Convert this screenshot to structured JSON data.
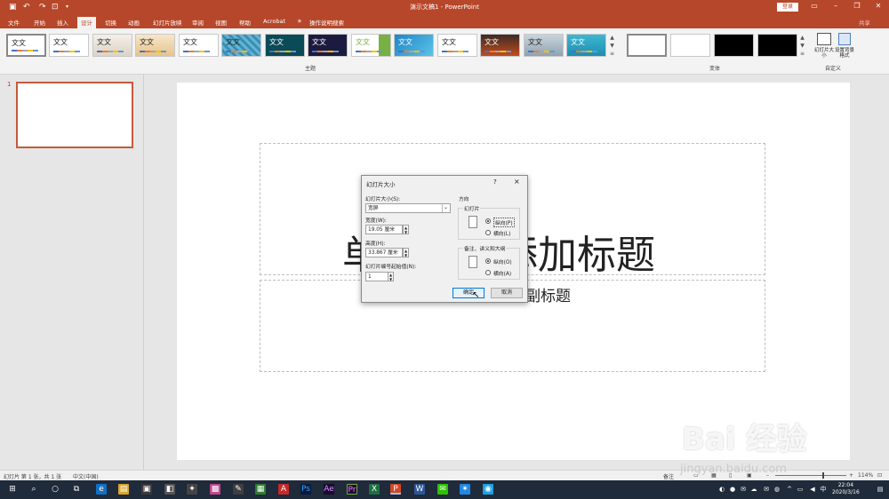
{
  "titlebar": {
    "doc_title": "演示文稿1  -  PowerPoint",
    "login": "登录",
    "share": "共享"
  },
  "tabs": [
    "文件",
    "开始",
    "插入",
    "设计",
    "切换",
    "动画",
    "幻灯片放映",
    "审阅",
    "视图",
    "帮助",
    "Acrobat",
    "操作说明搜索"
  ],
  "active_tab": "设计",
  "ribbon": {
    "theme_text": "文文",
    "theme_sample_label": "文文",
    "group_themes": "主题",
    "group_variants": "变体",
    "group_custom": "自定义",
    "btn_slide_size": "幻灯片大小",
    "btn_format_bg": "设置背景格式"
  },
  "thumbs": {
    "number": "1"
  },
  "slide": {
    "title": "单击此处添加标题",
    "subtitle": "单击此处添加副标题"
  },
  "dialog": {
    "title": "幻灯片大小",
    "help": "?",
    "close": "×",
    "size_label": "幻灯片大小(S):",
    "size_value": "宽屏",
    "width_label": "宽度(W):",
    "width_value": "19.05 厘米",
    "height_label": "高度(H):",
    "height_value": "33.867 厘米",
    "start_label": "幻灯片编号起始值(N):",
    "start_value": "1",
    "orientation": "方向",
    "slides_group": "幻灯片",
    "portrait": "纵向(P)",
    "landscape": "横向(L)",
    "notes_group": "备注、讲义和大纲",
    "notes_portrait": "纵向(O)",
    "notes_landscape": "横向(A)",
    "ok": "确定",
    "cancel": "取消"
  },
  "statusbar": {
    "slide_info": "幻灯片 第 1 张，共 1 张",
    "language": "中文(中国)",
    "notes": "备注",
    "zoom": "114%"
  },
  "taskbar": {
    "time": "22:04",
    "date": "2020/3/16"
  },
  "watermark": {
    "brand": "Bai 经验",
    "url": "jingyan.baidu.com"
  },
  "colors": {
    "accent": "#b7472a",
    "dialog_bg": "#f0f0f0",
    "taskbar": "#1f2a3a"
  }
}
